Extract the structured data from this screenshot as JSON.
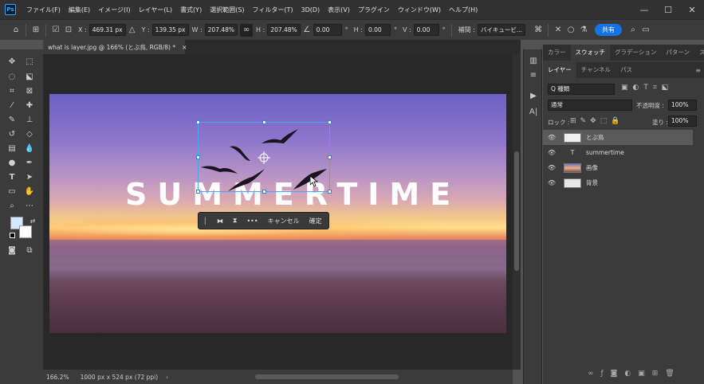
{
  "app": {
    "logo": "Ps"
  },
  "menu": [
    "ファイル(F)",
    "編集(E)",
    "イメージ(I)",
    "レイヤー(L)",
    "書式(Y)",
    "選択範囲(S)",
    "フィルター(T)",
    "3D(D)",
    "表示(V)",
    "プラグイン",
    "ウィンドウ(W)",
    "ヘルプ(H)"
  ],
  "window_controls": {
    "minimize": "—",
    "maximize": "☐",
    "close": "✕"
  },
  "options": {
    "x_label": "X :",
    "x_value": "469.31 px",
    "y_label": "Y :",
    "y_value": "139.35 px",
    "w_label": "W :",
    "w_value": "207.48%",
    "h_label": "H :",
    "h_value": "207.48%",
    "angle_value": "0.00",
    "angle_unit": "°",
    "hskew_label": "H :",
    "hskew_value": "0.00",
    "hskew_unit": "°",
    "vskew_label": "V :",
    "vskew_value": "0.00",
    "vskew_unit": "°",
    "interp_label": "補間 :",
    "interp_value": "バイキュービ...",
    "share_label": "共有"
  },
  "document": {
    "tab_title": "what is layer.jpg @ 166% (とぶ鳥, RGB/8) *",
    "tab_close": "×",
    "headline": "SUMMERTIME",
    "zoom": "166.2%",
    "size_info": "1000 px x 524 px (72 ppi)"
  },
  "context_bar": {
    "more": "•••",
    "cancel": "キャンセル",
    "confirm": "確定"
  },
  "panels": {
    "top_tabs": [
      "カラー",
      "スウォッチ",
      "グラデーション",
      "パターン",
      "スタイル"
    ],
    "layer_tabs": [
      "レイヤー",
      "チャンネル",
      "パス"
    ],
    "search_placeholder": "Q 種類",
    "blend_mode": "通常",
    "opacity_label": "不透明度 :",
    "opacity_value": "100%",
    "lock_label": "ロック :",
    "fill_label": "塗り :",
    "fill_value": "100%",
    "layers": [
      {
        "name": "とぶ鳥",
        "selected": true
      },
      {
        "name": "summertime",
        "type_icon": "T"
      },
      {
        "name": "画像"
      },
      {
        "name": "背景"
      }
    ]
  }
}
